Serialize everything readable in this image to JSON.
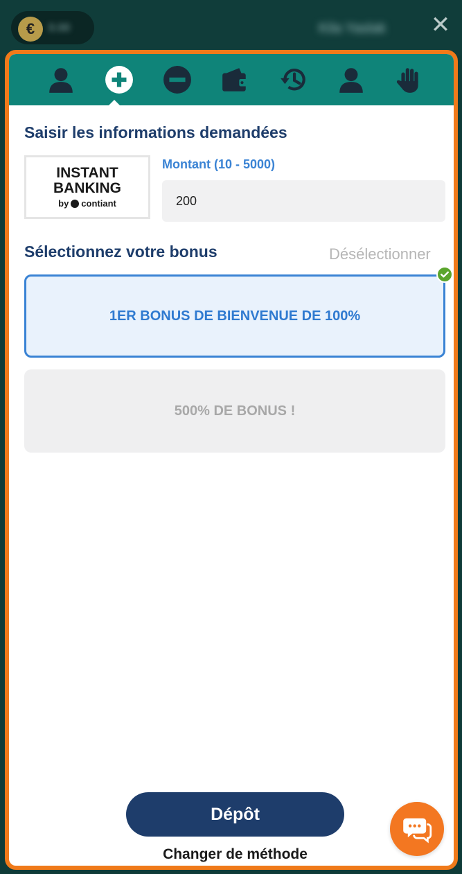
{
  "topbar": {
    "balance": "0.00",
    "username": "Kila Yaslak",
    "currency_symbol": "€"
  },
  "tabs": [
    {
      "name": "profile-icon"
    },
    {
      "name": "deposit-icon",
      "active": true
    },
    {
      "name": "withdraw-icon"
    },
    {
      "name": "wallet-icon"
    },
    {
      "name": "history-icon"
    },
    {
      "name": "account-icon"
    },
    {
      "name": "responsible-gaming-icon"
    }
  ],
  "form": {
    "title": "Saisir les informations demandées",
    "provider": {
      "line1": "INSTANT",
      "line2": "BANKING",
      "by": "by",
      "brand": "contiant"
    },
    "amount_label": "Montant (10 - 5000)",
    "amount_value": "200"
  },
  "bonus": {
    "title": "Sélectionnez votre bonus",
    "deselect_label": "Désélectionner",
    "options": [
      {
        "label": "1ER BONUS DE BIENVENUE DE 100%",
        "selected": true
      },
      {
        "label": "500% DE BONUS !",
        "selected": false
      }
    ]
  },
  "actions": {
    "deposit_label": "Dépôt",
    "change_method_label": "Changer de méthode"
  },
  "colors": {
    "accent_orange": "#f07a1a",
    "tab_teal": "#0f8479",
    "navy": "#1e3d6b",
    "link_blue": "#3a83d4",
    "check_green": "#5aa52c"
  }
}
